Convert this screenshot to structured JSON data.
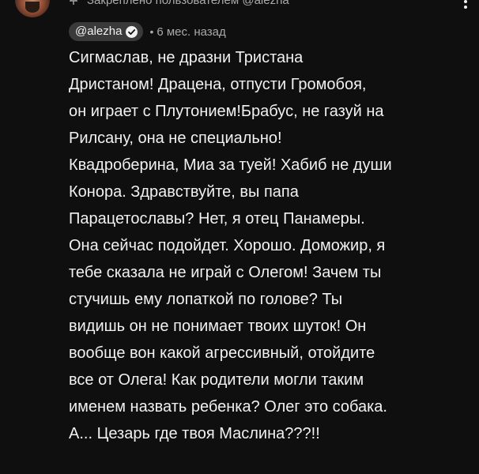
{
  "pinned": {
    "text": "Закреплено пользователем @alezha"
  },
  "comment": {
    "author": "@alezha",
    "timestamp": "6 мес. назад",
    "lines": [
      "Сигмаслав, не дразни Тристана",
      "Дристаном! Драцена, отпусти Громобоя,",
      "он играет с Плутонием!Брабус, не газуй на",
      "Рилсану, она не специально!",
      "Квадроберина, Миа за туей! Хабиб не души",
      "Конора. Здравствуйте, вы папа",
      "Парацетославы? Нет, я отец Панамеры.",
      "Она сейчас подойдет. Хорошо. Доможир, я",
      "тебе сказала не играй с Олегом! Зачем ты",
      "стучишь ему лопаткой по голове? Ты",
      "видишь он не понимает твоих шуток! Он",
      "вообще вон какой агрессивный, отойдите",
      "все от Олега! Как родители могли таким",
      "именем назвать ребенка? Олег это собака.",
      "А... Цезарь где твоя Маслина???!!"
    ]
  },
  "icons": {
    "pin": "pin-icon",
    "verified": "verified-check-icon",
    "more": "more-vertical-icon"
  },
  "colors": {
    "background": "#0f0f0f",
    "text": "#f1f1f1",
    "secondary_text": "#aaaaaa",
    "author_chip": "#3a3a3a"
  }
}
